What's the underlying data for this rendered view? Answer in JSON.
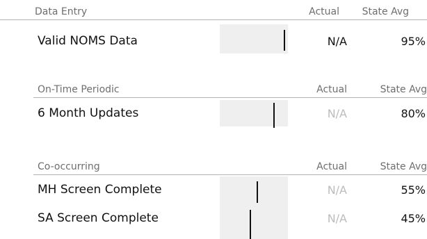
{
  "sections": [
    {
      "title": "Data Entry",
      "actual_header": "Actual",
      "avg_header": "State Avg",
      "rows": [
        {
          "label": "Valid NOMS Data",
          "actual": "N/A",
          "actual_dim": false,
          "state_avg": "95%",
          "state_avg_value": 95
        }
      ]
    },
    {
      "title": "On-Time Periodic",
      "actual_header": "Actual",
      "avg_header": "State Avg",
      "rows": [
        {
          "label": "6 Month Updates",
          "actual": "N/A",
          "actual_dim": true,
          "state_avg": "80%",
          "state_avg_value": 80
        }
      ]
    },
    {
      "title": "Co-occurring",
      "actual_header": "Actual",
      "avg_header": "State Avg",
      "rows": [
        {
          "label": "MH Screen Complete",
          "actual": "N/A",
          "actual_dim": true,
          "state_avg": "55%",
          "state_avg_value": 55
        },
        {
          "label": "SA Screen Complete",
          "actual": "N/A",
          "actual_dim": true,
          "state_avg": "45%",
          "state_avg_value": 45
        }
      ]
    }
  ],
  "colors": {
    "bar_background": "#efefef",
    "marker": "#111111",
    "header_text": "#6e6e6e",
    "dim_text": "#bcbcbc"
  }
}
